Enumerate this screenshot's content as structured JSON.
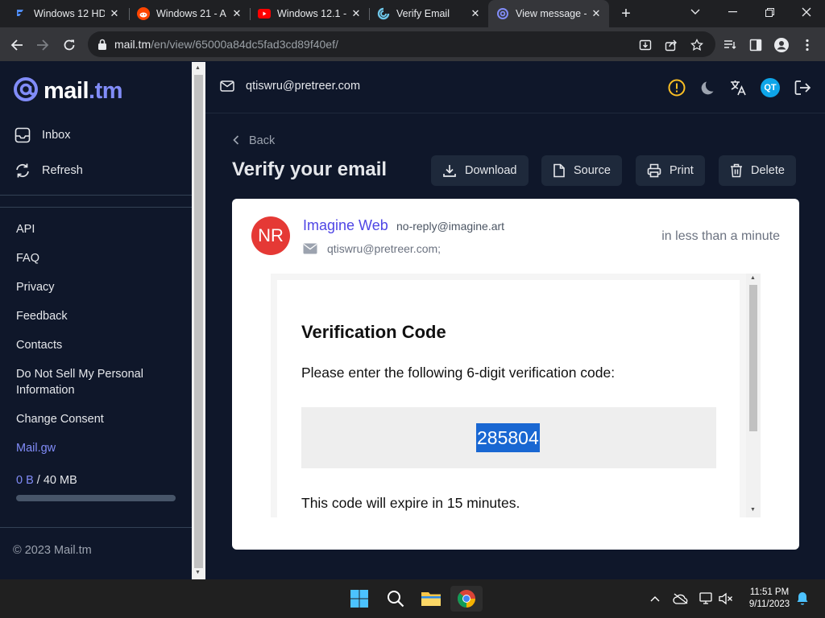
{
  "browser": {
    "tabs": [
      {
        "title": "Windows 12 HD",
        "icon": "generic-site-icon"
      },
      {
        "title": "Windows 21 - A",
        "icon": "reddit-icon"
      },
      {
        "title": "Windows 12.1 -",
        "icon": "youtube-icon"
      },
      {
        "title": "Verify Email",
        "icon": "generic-site-icon"
      },
      {
        "title": "View message -",
        "icon": "mail-tm-icon"
      }
    ],
    "url_host": "mail.tm",
    "url_path": "/en/view/65000a84dc5fad3cd89f40ef/"
  },
  "sidebar": {
    "logo_part1": "mail",
    "logo_part2": ".tm",
    "inbox": "Inbox",
    "refresh": "Refresh",
    "links": {
      "api": "API",
      "faq": "FAQ",
      "privacy": "Privacy",
      "feedback": "Feedback",
      "contacts": "Contacts",
      "dnsmpi": "Do Not Sell My Personal Information",
      "consent": "Change Consent",
      "mailgw": "Mail.gw"
    },
    "storage_used": "0 B",
    "storage_total": "/ 40 MB",
    "storage_fraction": 0.0,
    "copyright": "© 2023 Mail.tm"
  },
  "header": {
    "address": "qtiswru@pretreer.com",
    "avatar_initials": "QT"
  },
  "message": {
    "back": "Back",
    "title": "Verify your email",
    "actions": {
      "download": "Download",
      "source": "Source",
      "print": "Print",
      "delete": "Delete"
    },
    "sender_initials": "NR",
    "sender_name": "Imagine Web",
    "sender_email": "no-reply@imagine.art",
    "recipient": "qtiswru@pretreer.com;",
    "time": "in less than a minute",
    "body": {
      "heading": "Verification Code",
      "instruction": "Please enter the following 6-digit verification code:",
      "code": "285804",
      "expire": "This code will expire in 15 minutes."
    }
  },
  "taskbar": {
    "time": "11:51 PM",
    "date": "9/11/2023"
  },
  "colors": {
    "accent": "#818cf8",
    "background": "#0f172a",
    "button": "#1e293b",
    "sender_avatar": "#e53935",
    "code_highlight": "#1967d2"
  }
}
